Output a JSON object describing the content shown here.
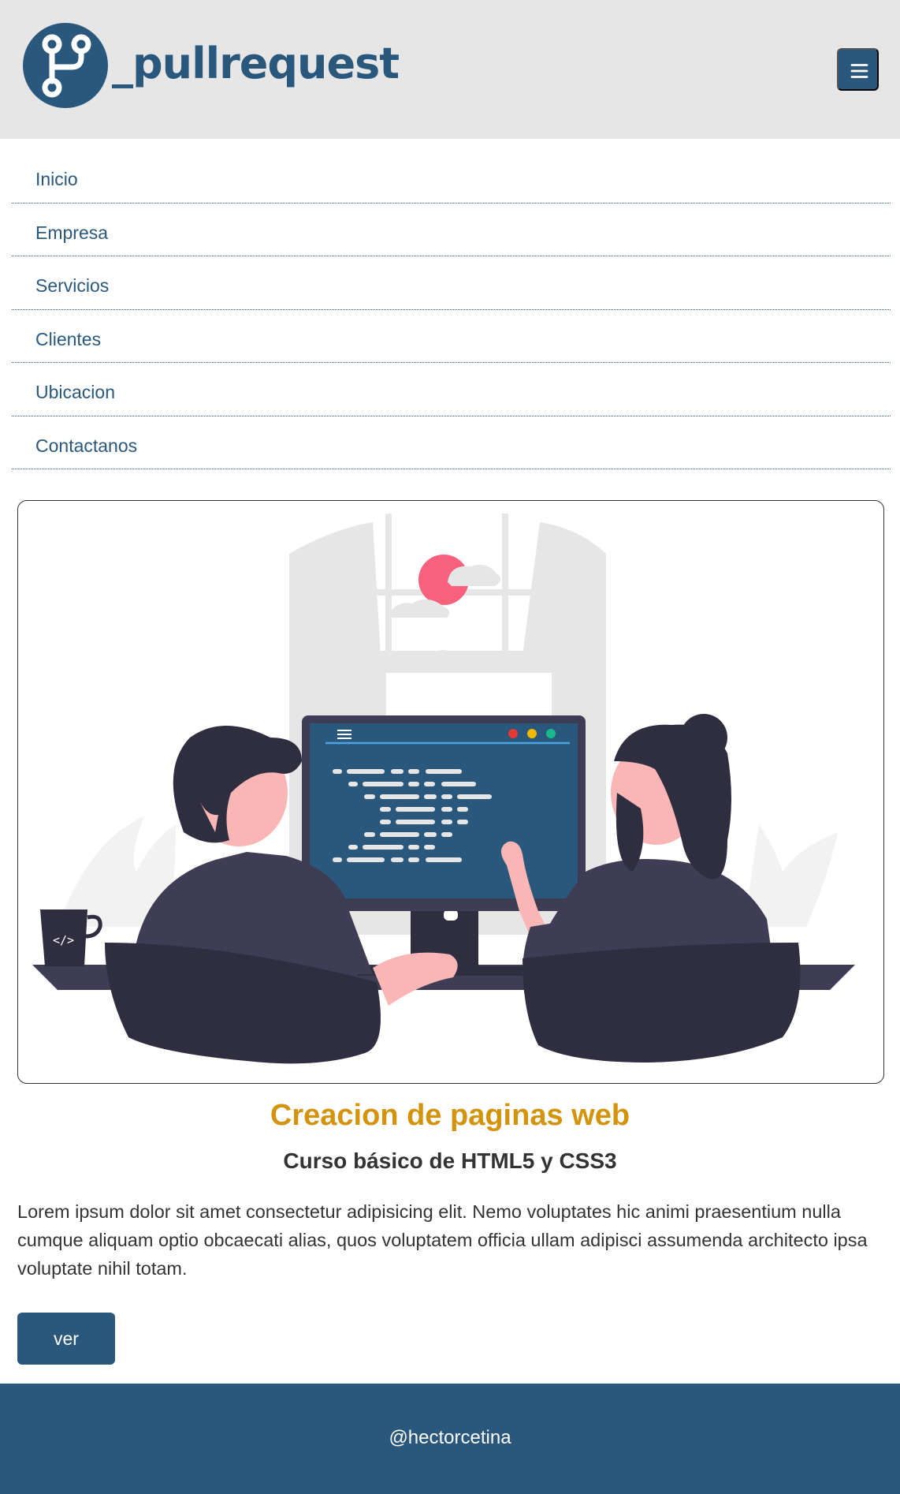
{
  "header": {
    "brand": "_pullrequest",
    "logo_icon": "git-branch-icon",
    "menu_icon": "hamburger-icon",
    "color": "#29587c"
  },
  "nav": {
    "items": [
      {
        "label": "Inicio"
      },
      {
        "label": "Empresa"
      },
      {
        "label": "Servicios"
      },
      {
        "label": "Clientes"
      },
      {
        "label": "Ubicacion"
      },
      {
        "label": "Contactanos"
      }
    ]
  },
  "hero": {
    "illustration": "two-people-coding-at-computer",
    "mug_label": "</>"
  },
  "content": {
    "title": "Creacion de paginas web",
    "title_color": "#d4930d",
    "subtitle": "Curso básico de HTML5 y CSS3",
    "paragraph": "Lorem ipsum dolor sit amet consectetur adipisicing elit. Nemo voluptates hic animi praesentium nulla cumque aliquam optio obcaecati alias, quos voluptatem officia ullam adipisci assumenda architecto ipsa voluptate nihil totam.",
    "button_label": "ver"
  },
  "footer": {
    "text": "@hectorcetina"
  }
}
